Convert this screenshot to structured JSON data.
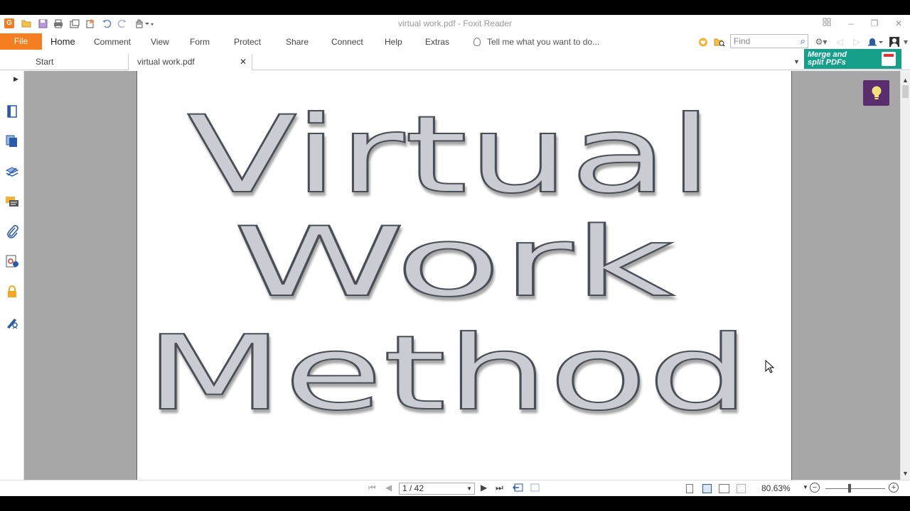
{
  "window": {
    "title": "virtual work.pdf - Foxit Reader",
    "app_logo": "G"
  },
  "menu": {
    "file": "File",
    "items": [
      "Home",
      "Comment",
      "View",
      "Form",
      "Protect",
      "Share",
      "Connect",
      "Help",
      "Extras"
    ],
    "tell_me": "Tell me what you want to do...",
    "find_placeholder": "Find"
  },
  "tabs": {
    "start": "Start",
    "doc": "virtual work.pdf"
  },
  "banner": {
    "line1": "Merge and",
    "line2": "split PDFs"
  },
  "document": {
    "lines": [
      "Virtual",
      "Work",
      "Method"
    ]
  },
  "status": {
    "page_value": "1 / 42",
    "zoom": "80.63%",
    "zoom_level": 0.4
  },
  "colors": {
    "accent": "#f57e20",
    "banner": "#15a08c",
    "hint": "#5a2e6e",
    "doc_bg": "#a7a7a7"
  }
}
